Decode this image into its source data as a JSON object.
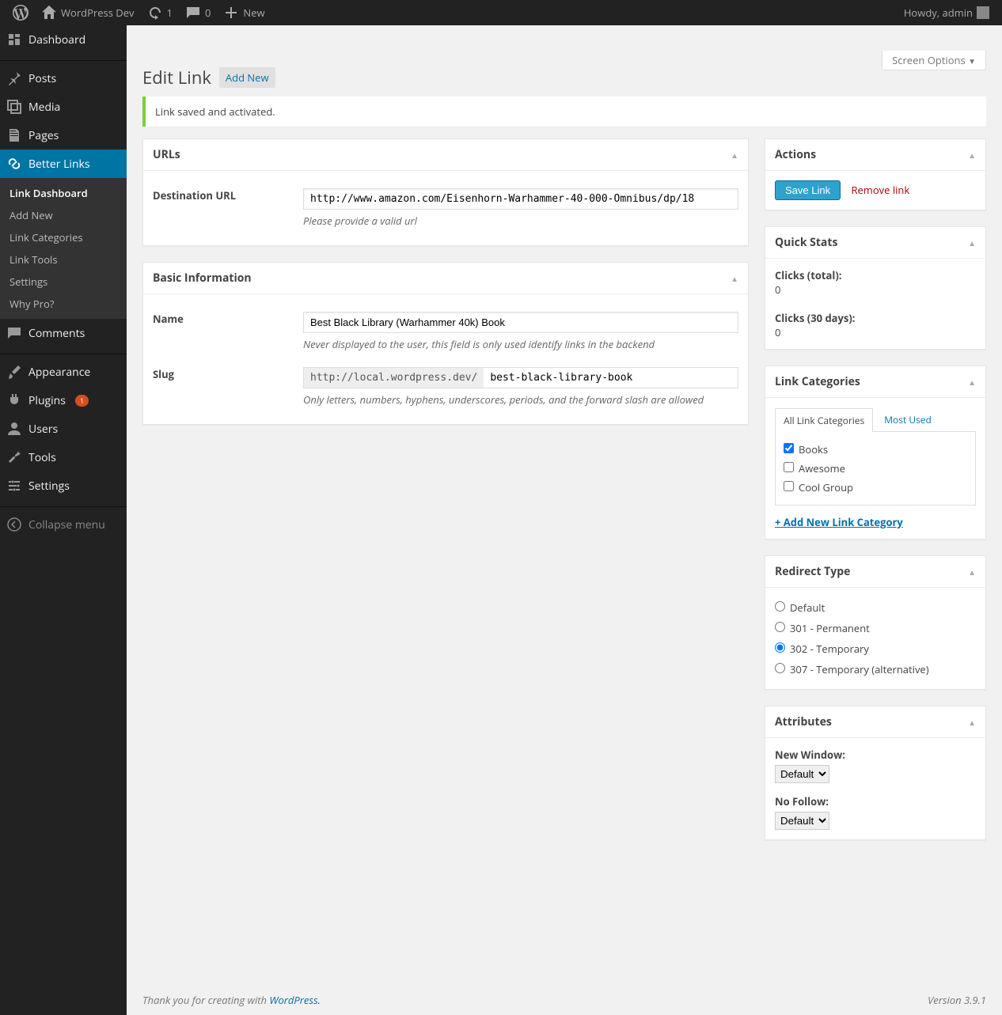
{
  "adminbar": {
    "site_name": "WordPress Dev",
    "updates": "1",
    "comments": "0",
    "new": "New",
    "howdy": "Howdy, admin"
  },
  "sidebar": {
    "items": [
      {
        "label": "Dashboard"
      },
      {
        "label": "Posts"
      },
      {
        "label": "Media"
      },
      {
        "label": "Pages"
      },
      {
        "label": "Better Links"
      },
      {
        "label": "Comments"
      },
      {
        "label": "Appearance"
      },
      {
        "label": "Plugins",
        "badge": "1"
      },
      {
        "label": "Users"
      },
      {
        "label": "Tools"
      },
      {
        "label": "Settings"
      },
      {
        "label": "Collapse menu"
      }
    ],
    "submenu": [
      {
        "label": "Link Dashboard"
      },
      {
        "label": "Add New"
      },
      {
        "label": "Link Categories"
      },
      {
        "label": "Link Tools"
      },
      {
        "label": "Settings"
      },
      {
        "label": "Why Pro?"
      }
    ]
  },
  "page": {
    "screen_options": "Screen Options",
    "title": "Edit Link",
    "add_new": "Add New",
    "notice": "Link saved and activated."
  },
  "main": {
    "urls": {
      "heading": "URLs",
      "dest_label": "Destination URL",
      "dest_value": "http://www.amazon.com/Eisenhorn-Warhammer-40-000-Omnibus/dp/18",
      "dest_desc": "Please provide a valid url"
    },
    "basic": {
      "heading": "Basic Information",
      "name_label": "Name",
      "name_value": "Best Black Library (Warhammer 40k) Book",
      "name_desc": "Never displayed to the user, this field is only used identify links in the backend",
      "slug_label": "Slug",
      "slug_prefix": "http://local.wordpress.dev/",
      "slug_value": "best-black-library-book",
      "slug_desc": "Only letters, numbers, hyphens, underscores, periods, and the forward slash are allowed"
    }
  },
  "side": {
    "actions": {
      "heading": "Actions",
      "save": "Save Link",
      "remove": "Remove link"
    },
    "stats": {
      "heading": "Quick Stats",
      "total_label": "Clicks (total):",
      "total_value": "0",
      "days_label": "Clicks (30 days):",
      "days_value": "0"
    },
    "categories": {
      "heading": "Link Categories",
      "tab_all": "All Link Categories",
      "tab_most": "Most Used",
      "items": [
        {
          "label": "Books",
          "checked": true
        },
        {
          "label": "Awesome",
          "checked": false
        },
        {
          "label": "Cool Group",
          "checked": false
        }
      ],
      "add_new": "+ Add New Link Category"
    },
    "redirect": {
      "heading": "Redirect Type",
      "options": [
        {
          "label": "Default",
          "checked": false
        },
        {
          "label": "301 - Permanent",
          "checked": false
        },
        {
          "label": "302 - Temporary",
          "checked": true
        },
        {
          "label": "307 - Temporary (alternative)",
          "checked": false
        }
      ]
    },
    "attributes": {
      "heading": "Attributes",
      "new_window_label": "New Window:",
      "new_window_value": "Default",
      "no_follow_label": "No Follow:",
      "no_follow_value": "Default"
    }
  },
  "footer": {
    "thank_pre": "Thank you for creating with ",
    "wp": "WordPress.",
    "version": "Version 3.9.1"
  }
}
